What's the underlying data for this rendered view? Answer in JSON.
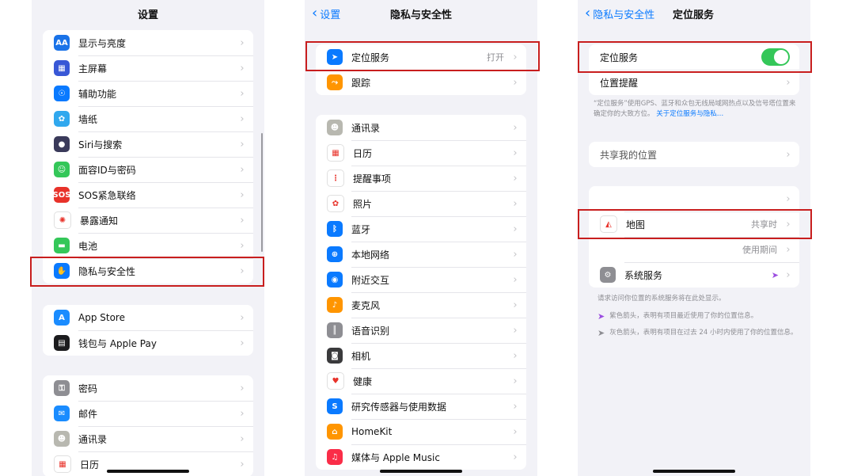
{
  "colors": {
    "accent": "#0a7aff",
    "toggle_on": "#34c759",
    "highlight_box": "#c81e1e",
    "location_arrow_purple": "#9b4de0"
  },
  "settings_screen": {
    "title": "设置",
    "group1": [
      {
        "label": "显示与亮度",
        "icon": "text-size-icon",
        "color": "#1a73e8",
        "glyph": "AA"
      },
      {
        "label": "主屏幕",
        "icon": "home-grid-icon",
        "color": "#3857d6",
        "glyph": "▦"
      },
      {
        "label": "辅助功能",
        "icon": "accessibility-icon",
        "color": "#0a7aff",
        "glyph": "☉"
      },
      {
        "label": "墙纸",
        "icon": "wallpaper-flower-icon",
        "color": "#30a8ee",
        "glyph": "✿"
      },
      {
        "label": "Siri与搜索",
        "icon": "siri-icon",
        "color": "#3a3a5a",
        "glyph": "●"
      },
      {
        "label": "面容ID与密码",
        "icon": "face-id-icon",
        "color": "#34c759",
        "glyph": "☺"
      },
      {
        "label": "SOS紧急联络",
        "icon": "sos-icon",
        "color": "#e8322a",
        "glyph": "SOS"
      },
      {
        "label": "暴露通知",
        "icon": "exposure-notification-icon",
        "color": "#ffffff",
        "glyph": "✺"
      },
      {
        "label": "电池",
        "icon": "battery-icon",
        "color": "#34c759",
        "glyph": "▬"
      },
      {
        "label": "隐私与安全性",
        "icon": "privacy-hand-icon",
        "color": "#0a7aff",
        "glyph": "✋"
      }
    ],
    "group2": [
      {
        "label": "App Store",
        "icon": "app-store-icon",
        "color": "#1a8cff",
        "glyph": "A"
      },
      {
        "label": "钱包与 Apple Pay",
        "icon": "wallet-icon",
        "color": "#1c1c1e",
        "glyph": "▤"
      }
    ],
    "group3": [
      {
        "label": "密码",
        "icon": "key-icon",
        "color": "#8e8e93",
        "glyph": "⚿"
      },
      {
        "label": "邮件",
        "icon": "mail-icon",
        "color": "#1a8cff",
        "glyph": "✉"
      },
      {
        "label": "通讯录",
        "icon": "contacts-icon",
        "color": "#b8b8b0",
        "glyph": "☻"
      },
      {
        "label": "日历",
        "icon": "calendar-icon",
        "color": "#ffffff",
        "glyph": "▦"
      }
    ]
  },
  "privacy_screen": {
    "back_label": "设置",
    "title": "隐私与安全性",
    "group1": [
      {
        "label": "定位服务",
        "value": "打开",
        "icon": "location-arrow-icon",
        "color": "#0a7aff",
        "glyph": "➤"
      },
      {
        "label": "跟踪",
        "value": "",
        "icon": "tracking-icon",
        "color": "#ff9500",
        "glyph": "⤳"
      }
    ],
    "group2": [
      {
        "label": "通讯录",
        "icon": "contacts-icon",
        "color": "#b8b8b0",
        "glyph": "☻"
      },
      {
        "label": "日历",
        "icon": "calendar-icon",
        "color": "#ffffff",
        "glyph": "▦"
      },
      {
        "label": "提醒事项",
        "icon": "reminders-icon",
        "color": "#ffffff",
        "glyph": "⋮"
      },
      {
        "label": "照片",
        "icon": "photos-icon",
        "color": "#ffffff",
        "glyph": "✿"
      },
      {
        "label": "蓝牙",
        "icon": "bluetooth-icon",
        "color": "#0a7aff",
        "glyph": "ᛒ"
      },
      {
        "label": "本地网络",
        "icon": "globe-icon",
        "color": "#0a7aff",
        "glyph": "⊕"
      },
      {
        "label": "附近交互",
        "icon": "nearby-interaction-icon",
        "color": "#0a7aff",
        "glyph": "◉"
      },
      {
        "label": "麦克风",
        "icon": "microphone-icon",
        "color": "#ff9500",
        "glyph": "♪"
      },
      {
        "label": "语音识别",
        "icon": "speech-recognition-icon",
        "color": "#8e8e93",
        "glyph": "║"
      },
      {
        "label": "相机",
        "icon": "camera-icon",
        "color": "#3a3a3c",
        "glyph": "◙"
      },
      {
        "label": "健康",
        "icon": "health-heart-icon",
        "color": "#ffffff",
        "glyph": "♥"
      },
      {
        "label": "研究传感器与使用数据",
        "icon": "research-sensor-icon",
        "color": "#0a7aff",
        "glyph": "S"
      },
      {
        "label": "HomeKit",
        "icon": "homekit-icon",
        "color": "#ff9500",
        "glyph": "⌂"
      },
      {
        "label": "媒体与 Apple Music",
        "icon": "music-icon",
        "color": "#fa2d48",
        "glyph": "♫"
      }
    ]
  },
  "location_screen": {
    "back_label": "隐私与安全性",
    "title": "定位服务",
    "toggle_label": "定位服务",
    "toggle_on": true,
    "alerts_label": "位置提醒",
    "description": "“定位服务”使用GPS、蓝牙和众包无线局域网热点以及信号塔位置来确定你的大致方位。",
    "description_link": "关于定位服务与隐私…",
    "share_label": "共享我的位置",
    "app_rows": [
      {
        "label": "",
        "value": "",
        "icon": "",
        "color": ""
      },
      {
        "label": "地图",
        "value": "共享时",
        "icon": "maps-icon",
        "color": "#ffffff",
        "glyph": "◭"
      },
      {
        "label": "",
        "value": "使用期间",
        "icon": "",
        "color": ""
      },
      {
        "label": "系统服务",
        "value": "",
        "icon": "gear-icon",
        "color": "#8e8e93",
        "glyph": "⚙"
      }
    ],
    "footer_note": "请求访问你位置的系统服务将在此处显示。",
    "legend": [
      {
        "text": "紫色箭头，表明有项目最近使用了你的位置信息。",
        "arrow": "purple-location-arrow-icon",
        "color": "#9b4de0"
      },
      {
        "text": "灰色箭头，表明有项目在过去 24 小时内使用了你的位置信息。",
        "arrow": "gray-location-arrow-icon",
        "color": "#8e8e93"
      }
    ]
  }
}
